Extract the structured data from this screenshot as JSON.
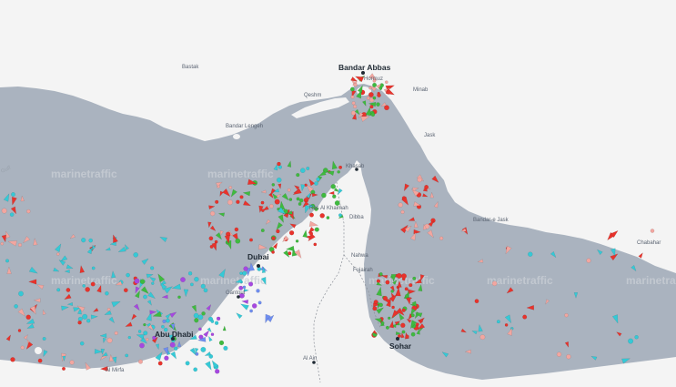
{
  "brand": {
    "watermark": "marinetraffic"
  },
  "colors": {
    "water": "#aab3bf",
    "land": "#f4f4f4",
    "border": "#8a8f97",
    "vessel_cargo": "#35c9d6",
    "vessel_tanker": "#e8332c",
    "vessel_passenger": "#3fba3f",
    "vessel_fishing": "#f2a6a0",
    "vessel_pleasure": "#a648e0",
    "vessel_other": "#6f8ef0"
  },
  "map": {
    "gulf_label": "Gulf",
    "major_labels": [
      {
        "text": "Bandar Abbas"
      },
      {
        "text": "Dubai"
      },
      {
        "text": "Abu Dhabi"
      },
      {
        "text": "Sohar"
      }
    ],
    "minor_labels": [
      {
        "text": "Khasab"
      },
      {
        "text": "Ras Al Khaimah"
      },
      {
        "text": "Gantout"
      },
      {
        "text": "Al Ain"
      },
      {
        "text": "Hormuz"
      },
      {
        "text": "Bandar Lengeh"
      },
      {
        "text": "Qeshm"
      },
      {
        "text": "Jask"
      },
      {
        "text": "Al Mirfa"
      },
      {
        "text": "Fujairah"
      },
      {
        "text": "Dibba"
      },
      {
        "text": "Nahwa"
      },
      {
        "text": "Bandar-e Jask"
      },
      {
        "text": "Chabahar"
      },
      {
        "text": "Minab"
      },
      {
        "text": "Bastak"
      }
    ]
  }
}
